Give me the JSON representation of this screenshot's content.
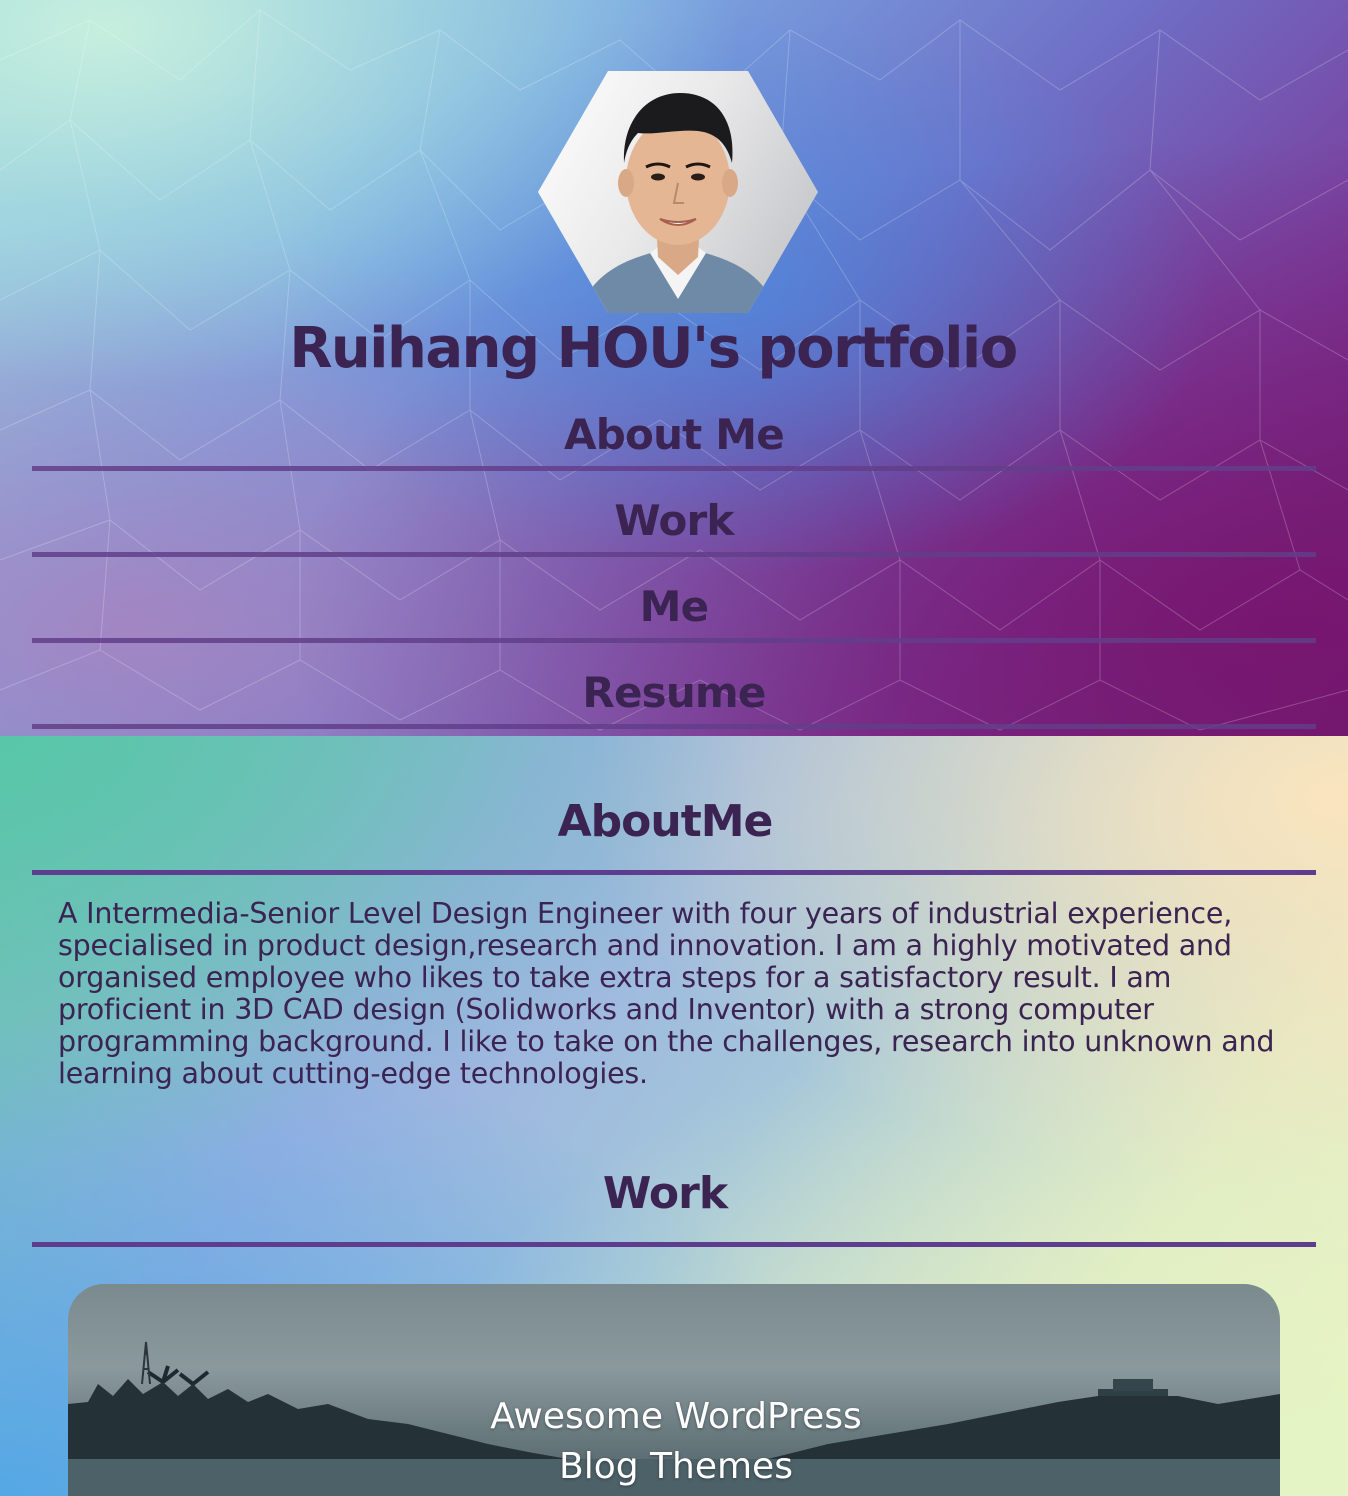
{
  "header": {
    "title": "Ruihang HOU's portfolio",
    "avatar_icon": "portrait-photo-hexagon",
    "nav": [
      {
        "label": "About Me"
      },
      {
        "label": "Work"
      },
      {
        "label": "Me"
      },
      {
        "label": "Resume"
      }
    ]
  },
  "about": {
    "heading": "AboutMe",
    "lines": [
      "A Intermedia-Senior Level Design Engineer with four years of industrial experience,",
      "specialised in product design,research and innovation. I am a highly motivated and",
      "organised employee who likes to take extra steps for a satisfactory result. I am",
      "proficient in 3D CAD design (Solidworks and Inventor) with a strong computer",
      "programming background. I like to take on the challenges, research into unknown and",
      "learning about cutting-edge technologies."
    ]
  },
  "work": {
    "heading": "Work",
    "card_title_line1": "Awesome WordPress",
    "card_title_line2": "Blog Themes"
  },
  "colors": {
    "text": "#3b2352",
    "rule": "#5f3d8e"
  }
}
